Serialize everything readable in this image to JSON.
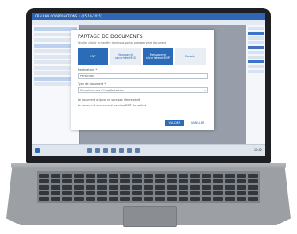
{
  "window": {
    "title": "CRH RAN COORDINATIONS 1 (15-10-2021) ..."
  },
  "dialog": {
    "title": "PARTAGE DE DOCUMENTS",
    "subtitle": "Veuillez choisir la manière dont vous voulez partager votre document",
    "options": [
      {
        "label": "ENP",
        "active": true
      },
      {
        "label": "Messagerie sécurisée MSS",
        "active": false
      },
      {
        "label": "Messagerie sécurisée et ENP",
        "active": true
      },
      {
        "label": "Dossier",
        "active": false
      }
    ],
    "field_1": {
      "label": "Destinataire *",
      "value": "Personnel"
    },
    "field_2": {
      "label": "Type de document *",
      "value": "Compte-rendu d'hospitalisation"
    },
    "note_1": "Le document original ne sera pas réenregistré",
    "note_2": "Le document sera envoyé aussi au DMP du patient",
    "primary_button": "VALIDER",
    "secondary_button": "ANNULER"
  },
  "taskbar": {
    "clock": "10:42"
  }
}
